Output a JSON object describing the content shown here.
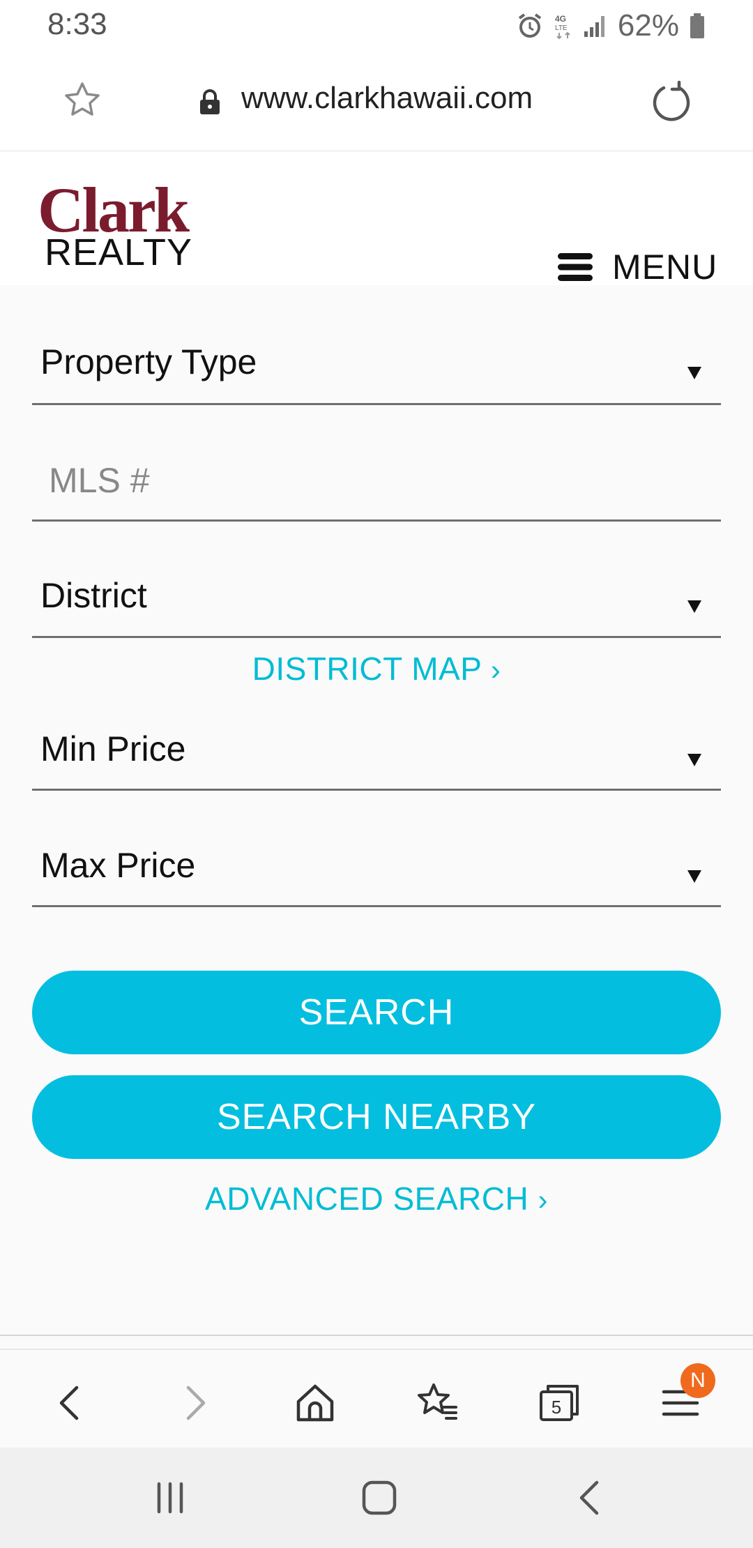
{
  "status_bar": {
    "time": "8:33",
    "battery_percent": "62%",
    "icons": [
      "alarm-icon",
      "4g-lte-icon",
      "signal-icon",
      "battery-icon"
    ]
  },
  "browser": {
    "url": "www.clarkhawaii.com",
    "tab_count": "5",
    "menu_badge": "N"
  },
  "header": {
    "logo_top": "Clark",
    "logo_bottom": "REALTY",
    "menu_label": "MENU"
  },
  "form": {
    "property_type": "Property Type",
    "mls_placeholder": "MLS #",
    "district": "District",
    "district_map_link": "DISTRICT MAP",
    "min_price": "Min Price",
    "max_price": "Max Price",
    "search_button": "SEARCH",
    "search_nearby_button": "SEARCH NEARBY",
    "advanced_search_link": "ADVANCED SEARCH"
  },
  "colors": {
    "brand_maroon": "#7b1c2e",
    "accent_teal": "#04bedf",
    "badge_orange": "#f06a1d"
  }
}
